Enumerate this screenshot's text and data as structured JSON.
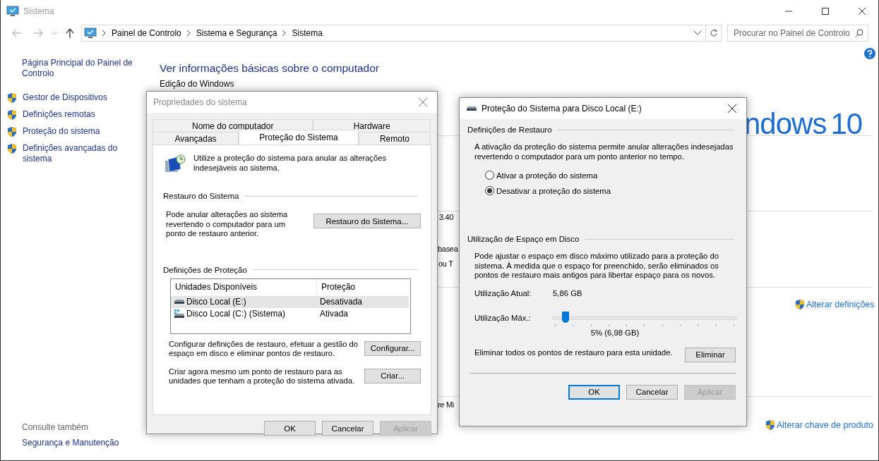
{
  "window": {
    "title": "Sistema"
  },
  "address_bar": {
    "breadcrumbs": [
      "Painel de Controlo",
      "Sistema e Segurança",
      "Sistema"
    ]
  },
  "search": {
    "placeholder": "Procurar no Painel de Controlo"
  },
  "sidebar": {
    "home_link": "Página Principal do Painel de Controlo",
    "items": [
      {
        "label": "Gestor de Dispositivos"
      },
      {
        "label": "Definições remotas"
      },
      {
        "label": "Proteção do sistema"
      },
      {
        "label": "Definições avançadas do sistema"
      }
    ],
    "see_also_title": "Consulte também",
    "see_also": [
      "Segurança e Manutenção"
    ]
  },
  "content": {
    "heading": "Ver informações básicas sobre o computador",
    "section_label": "Edição do Windows",
    "fragments": [
      "3.40",
      "basea",
      "ou T",
      "re Mi"
    ],
    "logo_text": "ndows",
    "logo_version": "10",
    "links": [
      "Alterar definições",
      "Alterar chave de produto"
    ]
  },
  "properties_dialog": {
    "title": "Propriedades do sistema",
    "tab_rows": [
      [
        {
          "label": "Nome do computador",
          "selected": false
        },
        {
          "label": "Hardware",
          "selected": false
        }
      ],
      [
        {
          "label": "Avançadas",
          "selected": false
        },
        {
          "label": "Proteção do Sistema",
          "selected": true
        },
        {
          "label": "Remoto",
          "selected": false
        }
      ]
    ],
    "intro": "Utilize a proteção do sistema para anular as alterações indesejáveis ao sistema.",
    "restore_group": {
      "title": "Restauro do Sistema",
      "text": "Pode anular alterações ao sistema revertendo o computador para um ponto de restauro anterior.",
      "button": "Restauro do Sistema..."
    },
    "protection_group": {
      "title": "Definições de Proteção",
      "columns": [
        "Unidades Disponíveis",
        "Proteção"
      ],
      "rows": [
        {
          "kind": "data",
          "drive": "Disco Local (E:)",
          "protection": "Desativada",
          "selected": true
        },
        {
          "kind": "system",
          "drive": "Disco Local (C:) (Sistema)",
          "protection": "Ativada",
          "selected": false
        }
      ],
      "actions": [
        {
          "text": "Configurar definições de restauro, efetuar a gestão do espaço em disco e eliminar pontos de restauro.",
          "button": "Configurar..."
        },
        {
          "text": "Criar agora mesmo um ponto de restauro para as unidades que tenham a proteção do sistema ativada.",
          "button": "Criar..."
        }
      ]
    },
    "buttons": [
      {
        "label": "OK",
        "disabled": false
      },
      {
        "label": "Cancelar",
        "disabled": false
      },
      {
        "label": "Aplicar",
        "disabled": true
      }
    ]
  },
  "protection_dialog": {
    "title": "Proteção do Sistema para Disco Local (E:)",
    "restore_group": {
      "title": "Definições de Restauro",
      "text": "A ativação da proteção do sistema permite anular alterações indesejadas revertendo o computador para um ponto anterior no tempo.",
      "options": [
        {
          "label": "Ativar a proteção do sistema",
          "selected": false
        },
        {
          "label": "Desativar a proteção do sistema",
          "selected": true
        }
      ]
    },
    "disk_group": {
      "title": "Utilização de Espaço em Disco",
      "text": "Pode ajustar o espaço em disco máximo utilizado para a proteção do sistema. À medida que o espaço for preenchido, serão eliminados os pontos de restauro mais antigos para libertar espaço para os novos.",
      "current_label": "Utilização Atual:",
      "current_value": "5,86 GB",
      "max_label": "Utilização Máx.:",
      "level": 0.05,
      "max_reading": "5% (6,98 GB)",
      "delete_text": "Eliminar todos os pontos de restauro para esta unidade.",
      "delete_button": "Eliminar"
    },
    "buttons": [
      {
        "label": "OK",
        "disabled": false,
        "default": true
      },
      {
        "label": "Cancelar",
        "disabled": false,
        "default": false
      },
      {
        "label": "Aplicar",
        "disabled": true,
        "default": false
      }
    ]
  }
}
